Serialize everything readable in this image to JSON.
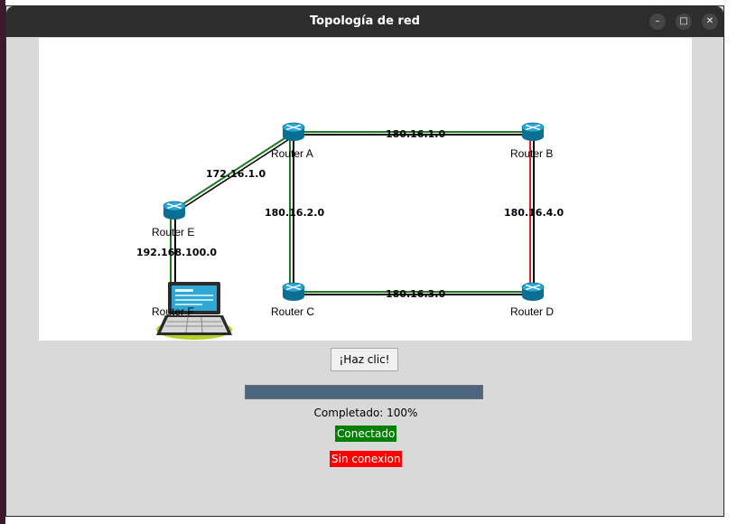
{
  "window": {
    "title": "Topología de red",
    "controls": {
      "minimize": "–",
      "maximize": "□",
      "close": "✕"
    }
  },
  "topology": {
    "nodes": [
      {
        "id": "A",
        "label": "Router A",
        "icon": "router-icon"
      },
      {
        "id": "B",
        "label": "Router B",
        "icon": "router-icon"
      },
      {
        "id": "C",
        "label": "Router C",
        "icon": "router-icon"
      },
      {
        "id": "D",
        "label": "Router D",
        "icon": "router-icon"
      },
      {
        "id": "E",
        "label": "Router E",
        "icon": "router-icon"
      },
      {
        "id": "F",
        "label": "Router F",
        "icon": "laptop-icon"
      }
    ],
    "links": [
      {
        "from": "A",
        "to": "B",
        "network": "180.16.1.0",
        "route": "#000000"
      },
      {
        "from": "A",
        "to": "C",
        "network": "180.16.2.0",
        "route": "#1f7a1f"
      },
      {
        "from": "C",
        "to": "D",
        "network": "180.16.3.0",
        "route": "#1f7a1f"
      },
      {
        "from": "B",
        "to": "D",
        "network": "180.16.4.0",
        "route": "#e02020"
      },
      {
        "from": "E",
        "to": "A",
        "network": "172.16.1.0",
        "route": "#1f7a1f"
      },
      {
        "from": "E",
        "to": "F",
        "network": "192.168.100.0",
        "route": "#1f7a1f"
      }
    ]
  },
  "action_button": {
    "label": "¡Haz clic!"
  },
  "progress": {
    "value": 1.0,
    "fill_color": "#4d6680"
  },
  "status": {
    "completed_text": "Completado:  100%",
    "connected": {
      "label": "Conectado",
      "color": "#008000"
    },
    "disconnected": {
      "label": "Sin conexion",
      "color": "#ff0000"
    }
  }
}
